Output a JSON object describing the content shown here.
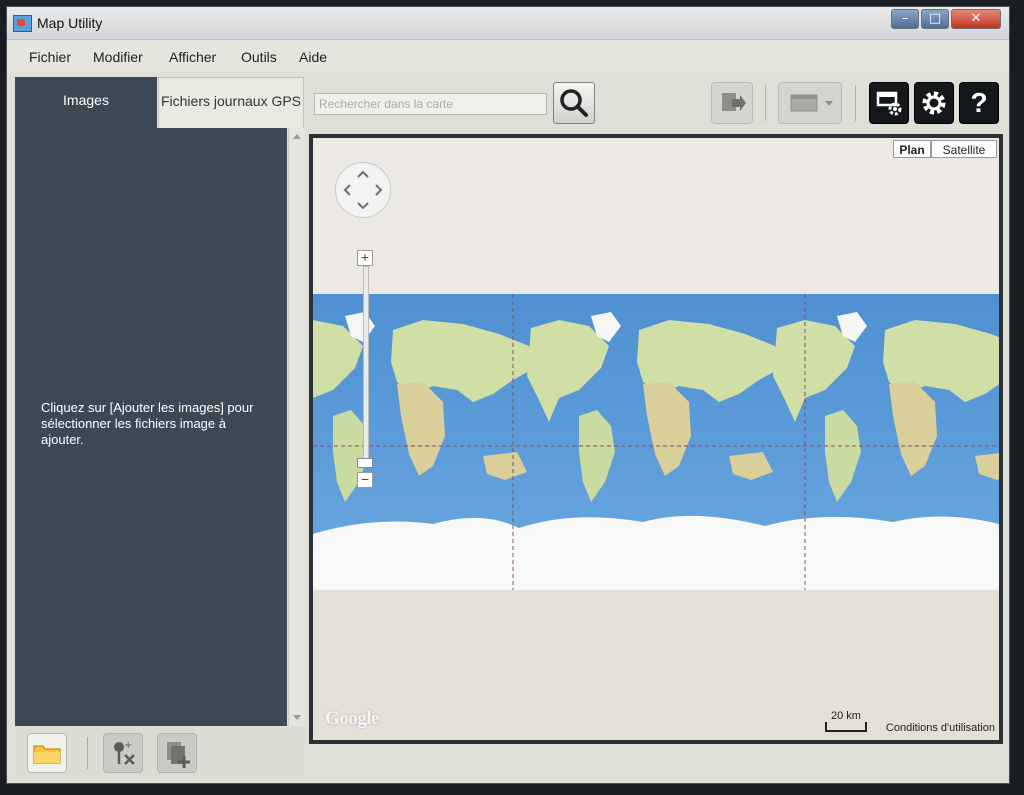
{
  "window": {
    "title": "Map Utility",
    "minimize_glyph": "–",
    "maximize_glyph": "□",
    "close_glyph": "✕"
  },
  "menu": [
    "Fichier",
    "Modifier",
    "Afficher",
    "Outils",
    "Aide"
  ],
  "tabs": [
    {
      "label": "Images",
      "active": true
    },
    {
      "label": "Fichiers journaux GPS",
      "active": false
    }
  ],
  "search": {
    "placeholder": "Rechercher dans la carte",
    "icon": "search-icon"
  },
  "toolbar": {
    "buttons": [
      "export-icon",
      "view-icon",
      "settings-tools-icon",
      "gear-icon",
      "help-icon"
    ],
    "help_glyph": "?"
  },
  "left_panel": {
    "message": "Cliquez sur [Ajouter les images] pour sélectionner les fichiers image à ajouter."
  },
  "bottom_buttons": [
    "folder-icon",
    "pin-remove-icon",
    "add-images-icon"
  ],
  "map": {
    "type_buttons": [
      "Plan",
      "Satellite"
    ],
    "selected_type": "Plan",
    "zoom_in": "+",
    "zoom_out": "−",
    "logo": "Google",
    "scale": "20 km",
    "terms": "Conditions d'utilisation"
  },
  "colors": {
    "panel": "#3b4954",
    "ocean": "#5d9fd8",
    "land": "#c9dca0",
    "ice": "#ffffff"
  }
}
